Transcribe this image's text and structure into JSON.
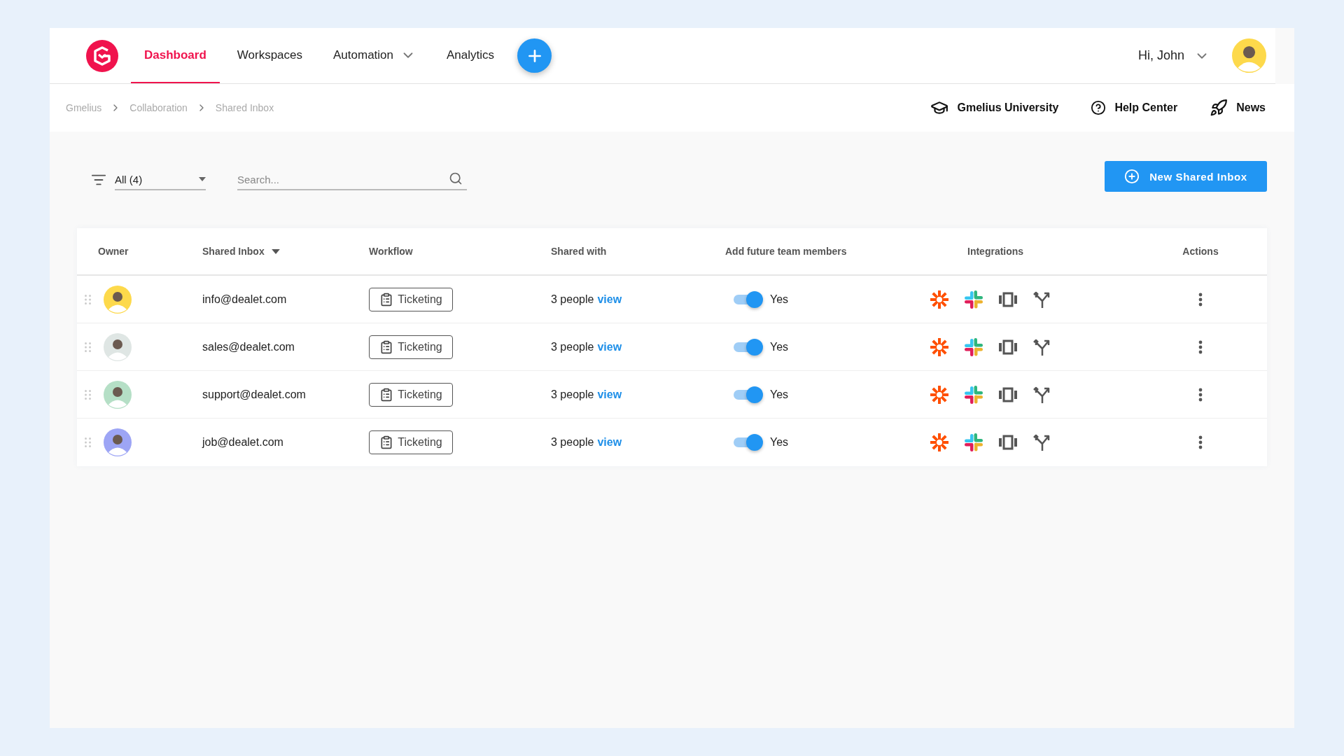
{
  "nav": {
    "items": [
      {
        "label": "Dashboard",
        "selected": true,
        "has_menu": false
      },
      {
        "label": "Workspaces",
        "selected": false,
        "has_menu": false
      },
      {
        "label": "Automation",
        "selected": false,
        "has_menu": true
      },
      {
        "label": "Analytics",
        "selected": false,
        "has_menu": false
      }
    ]
  },
  "user": {
    "greeting": "Hi, John",
    "color": "#fdd94b"
  },
  "breadcrumb": [
    "Gmelius",
    "Collaboration",
    "Shared Inbox"
  ],
  "help_links": [
    {
      "kind": "university",
      "label": "Gmelius University"
    },
    {
      "kind": "help",
      "label": "Help Center"
    },
    {
      "kind": "news",
      "label": "News"
    }
  ],
  "filter": {
    "value": "All (4)"
  },
  "search": {
    "placeholder": "Search..."
  },
  "new_button": "New Shared Inbox",
  "table": {
    "columns": [
      {
        "label": "Owner",
        "sortable": false
      },
      {
        "label": "Shared Inbox",
        "sortable": true
      },
      {
        "label": "Workflow",
        "sortable": false
      },
      {
        "label": "Shared with",
        "sortable": false
      },
      {
        "label": "Add future team members",
        "sortable": false
      },
      {
        "label": "Integrations",
        "sortable": false
      },
      {
        "label": "Actions",
        "sortable": false
      }
    ],
    "rows": [
      {
        "color": "#fdd94b",
        "inbox": "info@dealet.com",
        "workflow": "Ticketing",
        "shared_with": "3 people",
        "link": "view",
        "add_future": true,
        "add_future_label": "Yes"
      },
      {
        "color": "#dfe6e4",
        "inbox": "sales@dealet.com",
        "workflow": "Ticketing",
        "shared_with": "3 people",
        "link": "view",
        "add_future": true,
        "add_future_label": "Yes"
      },
      {
        "color": "#b5dfc6",
        "inbox": "support@dealet.com",
        "workflow": "Ticketing",
        "shared_with": "3 people",
        "link": "view",
        "add_future": true,
        "add_future_label": "Yes"
      },
      {
        "color": "#9da5f5",
        "inbox": "job@dealet.com",
        "workflow": "Ticketing",
        "shared_with": "3 people",
        "link": "view",
        "add_future": true,
        "add_future_label": "Yes"
      }
    ]
  }
}
